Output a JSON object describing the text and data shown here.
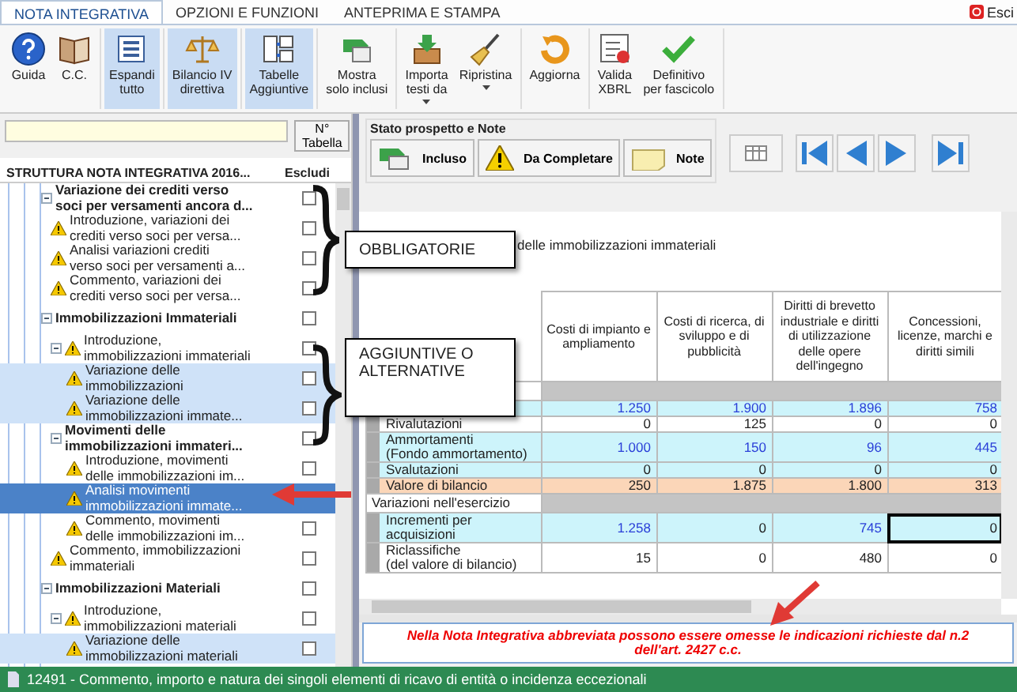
{
  "tabs": [
    {
      "label": "NOTA INTEGRATIVA",
      "selected": true
    },
    {
      "label": "OPZIONI E FUNZIONI",
      "selected": false
    },
    {
      "label": "ANTEPRIMA E STAMPA",
      "selected": false
    }
  ],
  "exit_button": {
    "label": "Esci"
  },
  "ribbon": {
    "groups": [
      [
        {
          "label": "Guida",
          "kind": "help",
          "on": false,
          "dropdown": false
        },
        {
          "label": "C.C.",
          "kind": "book",
          "on": false,
          "dropdown": false
        }
      ],
      [
        {
          "label": "Espandi\ntutto",
          "kind": "list",
          "on": true,
          "dropdown": false
        }
      ],
      [
        {
          "label": "Bilancio IV\ndirettiva",
          "kind": "scales",
          "on": true,
          "dropdown": false
        }
      ],
      [
        {
          "label": "Tabelle\nAggiuntive",
          "kind": "tables",
          "on": true,
          "dropdown": false
        }
      ],
      [
        {
          "label": "Mostra\nsolo inclusi",
          "kind": "show",
          "on": false,
          "dropdown": false
        }
      ],
      [
        {
          "label": "Importa\ntesti da",
          "kind": "import",
          "on": false,
          "dropdown": true
        },
        {
          "label": "Ripristina",
          "kind": "brush",
          "on": false,
          "dropdown": true
        }
      ],
      [
        {
          "label": "Aggiorna",
          "kind": "refresh",
          "on": false,
          "dropdown": false
        }
      ],
      [
        {
          "label": "Valida\nXBRL",
          "kind": "validate",
          "on": false,
          "dropdown": false
        },
        {
          "label": "Definitivo\nper fascicolo",
          "kind": "check",
          "on": false,
          "dropdown": false
        }
      ]
    ]
  },
  "sidebar": {
    "table_number_button": "N° Tabella",
    "header": "STRUTTURA NOTA INTEGRATIVA 2016...",
    "exclude_header": "Escludi",
    "items": [
      {
        "label": "Variazione dei crediti verso\nsoci per versamenti ancora d...",
        "kind": "section",
        "expanded": true,
        "selected": false,
        "highlighted": false,
        "excluded": false,
        "children": [
          {
            "label": "Introduzione, variazioni dei\ncrediti verso soci per versa...",
            "kind": "item",
            "selected": false,
            "highlighted": false,
            "excluded": false
          },
          {
            "label": "Analisi variazioni crediti\nverso soci per versamenti a...",
            "kind": "item",
            "selected": false,
            "highlighted": false,
            "excluded": false
          },
          {
            "label": "Commento, variazioni dei\ncrediti verso soci per versa...",
            "kind": "item",
            "selected": false,
            "highlighted": false,
            "excluded": false
          }
        ]
      },
      {
        "label": "Immobilizzazioni Immateriali",
        "kind": "section",
        "expanded": true,
        "selected": false,
        "highlighted": false,
        "excluded": false,
        "children": [
          {
            "label": "Introduzione,\nimmobilizzazioni immateriali",
            "kind": "item",
            "expanded": true,
            "selected": false,
            "highlighted": false,
            "excluded": false,
            "children": [
              {
                "label": "Variazione delle\nimmobilizzazioni",
                "kind": "item",
                "selected": false,
                "highlighted": true,
                "excluded": false
              },
              {
                "label": "Variazione delle\nimmobilizzazioni immate...",
                "kind": "item",
                "selected": false,
                "highlighted": true,
                "excluded": false
              }
            ]
          },
          {
            "label": "Movimenti delle\nimmobilizzazioni immateri...",
            "kind": "section",
            "expanded": true,
            "selected": false,
            "highlighted": false,
            "excluded": false,
            "children": [
              {
                "label": "Introduzione, movimenti\ndelle immobilizzazioni im...",
                "kind": "item",
                "selected": false,
                "highlighted": false,
                "excluded": false
              },
              {
                "label": "Analisi movimenti\nimmobilizzazioni immate...",
                "kind": "item",
                "selected": true,
                "highlighted": false
              },
              {
                "label": "Commento, movimenti\ndelle immobilizzazioni im...",
                "kind": "item",
                "selected": false,
                "highlighted": false,
                "excluded": false
              }
            ]
          },
          {
            "label": "Commento, immobilizzazioni\nimmateriali",
            "kind": "item",
            "selected": false,
            "highlighted": false,
            "excluded": false
          }
        ]
      },
      {
        "label": "Immobilizzazioni Materiali",
        "kind": "section",
        "expanded": true,
        "selected": false,
        "highlighted": false,
        "excluded": false,
        "children": [
          {
            "label": "Introduzione,\nimmobilizzazioni materiali",
            "kind": "item",
            "expanded": true,
            "selected": false,
            "highlighted": false,
            "excluded": false,
            "children": [
              {
                "label": "Variazione delle\nimmobilizzazioni materiali",
                "kind": "item",
                "selected": false,
                "highlighted": true,
                "excluded": false
              }
            ]
          }
        ]
      }
    ]
  },
  "status_panel": {
    "title": "Stato prospetto e Note",
    "buttons": [
      {
        "label": "Incluso",
        "kind": "included"
      },
      {
        "label": "Da Completare",
        "kind": "warning"
      },
      {
        "label": "Note",
        "kind": "note"
      }
    ]
  },
  "table": {
    "title": "delle immobilizzazioni immateriali",
    "columns": [
      "Costi di impianto e ampliamento",
      "Costi di ricerca, di sviluppo e di pubblicità",
      "Diritti di brevetto industriale e diritti di utilizzazione delle opere dell'ingegno",
      "Concessioni, licenze, marchi e diritti simili"
    ],
    "rows": [
      {
        "kind": "section"
      },
      {
        "kind": "input",
        "cells": [
          {
            "value": "1.250",
            "edited": true,
            "selected": false
          },
          {
            "value": "1.900",
            "edited": true,
            "selected": false
          },
          {
            "value": "1.896",
            "edited": true,
            "selected": false
          },
          {
            "value": "758",
            "edited": true,
            "selected": false
          }
        ]
      },
      {
        "kind": "calc",
        "label": "Rivalutazioni",
        "cells": [
          {
            "value": "0",
            "edited": false,
            "selected": false
          },
          {
            "value": "125",
            "edited": false,
            "selected": false
          },
          {
            "value": "0",
            "edited": false,
            "selected": false
          },
          {
            "value": "0",
            "edited": false,
            "selected": false
          }
        ]
      },
      {
        "kind": "input",
        "label": "Ammortamenti\n(Fondo ammortamento)",
        "cells": [
          {
            "value": "1.000",
            "edited": true,
            "selected": false
          },
          {
            "value": "150",
            "edited": true,
            "selected": false
          },
          {
            "value": "96",
            "edited": true,
            "selected": false
          },
          {
            "value": "445",
            "edited": true,
            "selected": false
          }
        ]
      },
      {
        "kind": "input",
        "label": "Svalutazioni",
        "cells": [
          {
            "value": "0",
            "edited": false,
            "selected": false
          },
          {
            "value": "0",
            "edited": false,
            "selected": false
          },
          {
            "value": "0",
            "edited": false,
            "selected": false
          },
          {
            "value": "0",
            "edited": false,
            "selected": false
          }
        ]
      },
      {
        "kind": "total",
        "label": "Valore di bilancio",
        "cells": [
          {
            "value": "250",
            "edited": false,
            "selected": false
          },
          {
            "value": "1.875",
            "edited": false,
            "selected": false
          },
          {
            "value": "1.800",
            "edited": false,
            "selected": false
          },
          {
            "value": "313",
            "edited": false,
            "selected": false
          }
        ]
      },
      {
        "kind": "section",
        "label": "Variazioni nell'esercizio"
      },
      {
        "kind": "input",
        "label": "Incrementi per\nacquisizioni",
        "cells": [
          {
            "value": "1.258",
            "edited": true,
            "selected": false
          },
          {
            "value": "0",
            "edited": false,
            "selected": false
          },
          {
            "value": "745",
            "edited": true,
            "selected": false
          },
          {
            "value": "0",
            "edited": false,
            "selected": true
          }
        ]
      },
      {
        "kind": "calc",
        "label": "Riclassifiche\n(del valore di bilancio)",
        "cells": [
          {
            "value": "15",
            "edited": false,
            "selected": false
          },
          {
            "value": "0",
            "edited": false,
            "selected": false
          },
          {
            "value": "480",
            "edited": false,
            "selected": false
          },
          {
            "value": "0",
            "edited": false,
            "selected": false
          }
        ]
      }
    ]
  },
  "message": "Nella Nota Integrativa abbreviata possono essere omesse le indicazioni richieste dal n.2 dell'art. 2427 c.c.",
  "status_bar": {
    "text": "12491 - Commento, importo e natura dei singoli elementi di ricavo di entità o incidenza eccezionali"
  },
  "callouts": [
    {
      "text": "OBBLIGATORIE"
    },
    {
      "text": "AGGIUNTIVE O\nALTERNATIVE"
    }
  ]
}
